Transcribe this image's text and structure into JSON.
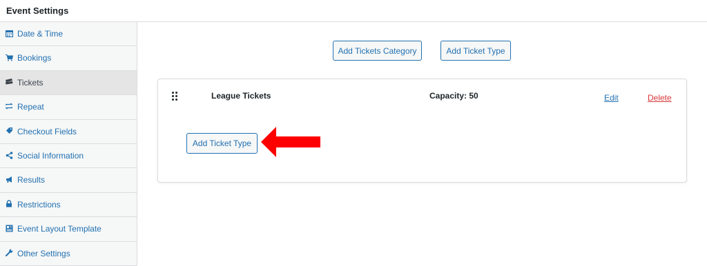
{
  "header": {
    "title": "Event Settings"
  },
  "sidebar": {
    "items": [
      {
        "label": "Date & Time",
        "icon": "calendar-icon"
      },
      {
        "label": "Bookings",
        "icon": "cart-icon"
      },
      {
        "label": "Tickets",
        "icon": "tickets-icon",
        "active": true
      },
      {
        "label": "Repeat",
        "icon": "repeat-icon"
      },
      {
        "label": "Checkout Fields",
        "icon": "tag-icon"
      },
      {
        "label": "Social Information",
        "icon": "share-icon"
      },
      {
        "label": "Results",
        "icon": "megaphone-icon"
      },
      {
        "label": "Restrictions",
        "icon": "lock-icon"
      },
      {
        "label": "Event Layout Template",
        "icon": "layout-icon"
      },
      {
        "label": "Other Settings",
        "icon": "wrench-icon"
      }
    ]
  },
  "main": {
    "add_category_label": "Add Tickets Category",
    "add_type_label": "Add Ticket Type",
    "category": {
      "name": "League Tickets",
      "capacity": "Capacity: 50",
      "edit_label": "Edit",
      "delete_label": "Delete",
      "add_type_label": "Add Ticket Type"
    }
  },
  "colors": {
    "accent": "#2271b1",
    "danger": "#d63638",
    "annotation_arrow": "#ff0000"
  }
}
